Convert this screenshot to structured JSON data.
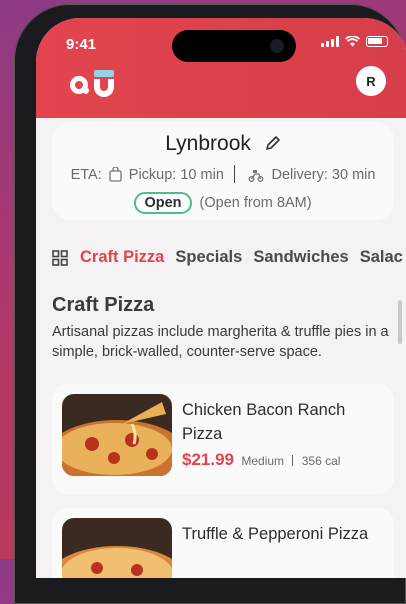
{
  "status_bar": {
    "time": "9:41"
  },
  "header": {
    "logo_icon": "qu-logo",
    "avatar_initial": "R",
    "color": "#e2454e"
  },
  "store": {
    "name": "Lynbrook",
    "eta_label": "ETA:",
    "pickup": "Pickup: 10 min",
    "delivery": "Delivery: 30 min",
    "status_badge": "Open",
    "hours_note": "(Open from 8AM)"
  },
  "categories": {
    "tabs": [
      "Craft Pizza",
      "Specials",
      "Sandwiches",
      "Salac"
    ],
    "active_index": 0
  },
  "section": {
    "title": "Craft Pizza",
    "description": "Artisanal pizzas include margherita & truffle pies in a simple, brick-walled, counter-serve space."
  },
  "items": [
    {
      "name": "Chicken Bacon Ranch Pizza",
      "price": "$21.99",
      "size": "Medium",
      "calories": "356 cal"
    },
    {
      "name": "Truffle & Pepperoni Pizza"
    }
  ],
  "colors": {
    "accent": "#e2454e",
    "open_green": "#49c084"
  }
}
